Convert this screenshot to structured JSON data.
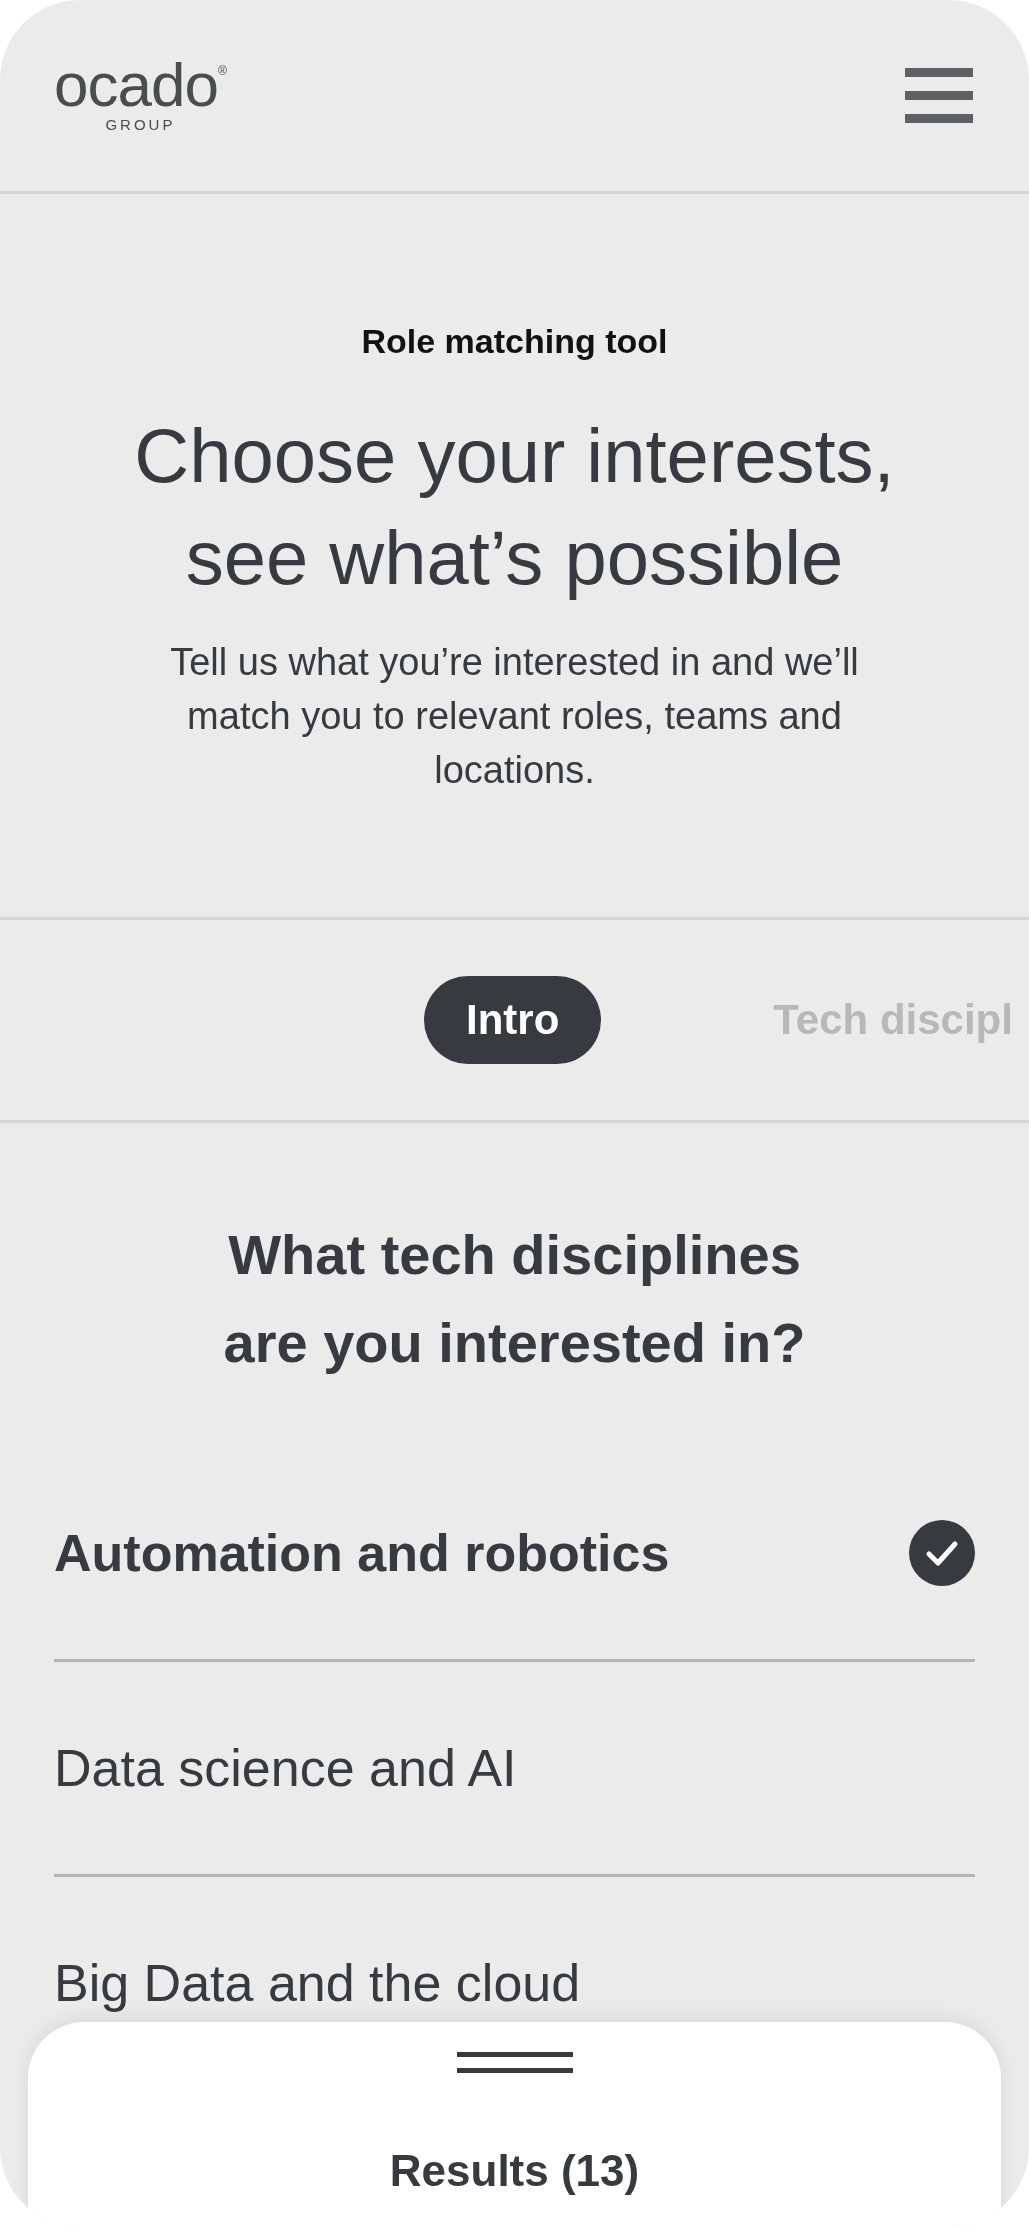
{
  "header": {
    "logo": {
      "wordmark": "ocado",
      "registered": "®",
      "subline": "GROUP"
    }
  },
  "intro": {
    "eyebrow": "Role matching tool",
    "title_lines": [
      "Choose your interests,",
      "see what’s possible"
    ],
    "description": "Tell us what you’re interested in and we’ll match you to relevant roles, teams and locations."
  },
  "tabs": [
    {
      "label": "Intro",
      "selected": true
    },
    {
      "label": "Tech discipl",
      "selected": false
    }
  ],
  "question": {
    "title_lines": [
      "What tech disciplines",
      "are you interested in?"
    ]
  },
  "options": [
    {
      "label": "Automation and robotics",
      "selected": true
    },
    {
      "label": "Data science and AI",
      "selected": false
    },
    {
      "label": "Big Data and the cloud",
      "selected": false
    }
  ],
  "results_sheet": {
    "label": "Results (13)"
  }
}
